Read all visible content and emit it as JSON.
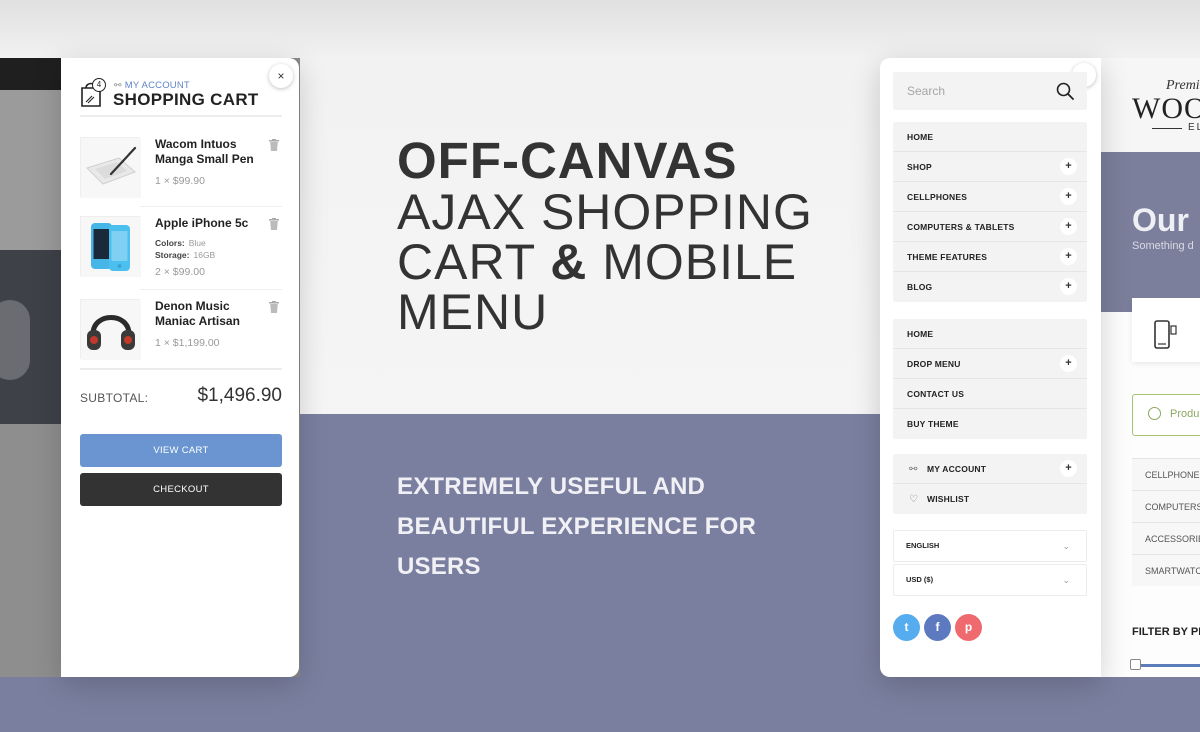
{
  "colors": {
    "accent_blue": "#6a95d1",
    "dark_button": "#333333",
    "bottom_band": "#7a7f9f",
    "twitter": "#55acee",
    "facebook": "#5d7ac0",
    "pinterest": "#ef6a6e"
  },
  "cart": {
    "count": "4",
    "my_account": "MY ACCOUNT",
    "title": "SHOPPING CART",
    "close_icon": "×",
    "items": [
      {
        "name": "Wacom Intuos Manga Small Pen",
        "qty_price": "1 × $99.90",
        "icon": "tablet-pen-thumbnail"
      },
      {
        "name": "Apple iPhone 5c",
        "attr1_label": "Colors:",
        "attr1_value": "Blue",
        "attr2_label": "Storage:",
        "attr2_value": "16GB",
        "qty_price": "2 × $99.00",
        "icon": "iphone-thumbnail"
      },
      {
        "name": "Denon Music Maniac Artisan",
        "qty_price": "1 × $1,199.00",
        "icon": "headphones-thumbnail"
      }
    ],
    "subtotal_label": "SUBTOTAL:",
    "subtotal_value": "$1,496.90",
    "view_cart": "VIEW CART",
    "checkout": "CHECKOUT"
  },
  "headline": {
    "line1": "OFF-CANVAS",
    "line2": "AJAX SHOPPING",
    "line3_a": "CART ",
    "line3_amp": "&",
    "line3_b": " MOBILE",
    "line4": "MENU",
    "sub1": "EXTREMELY USEFUL AND",
    "sub2": "BEAUTIFUL EXPERIENCE FOR",
    "sub3": "USERS"
  },
  "menu": {
    "close_icon": "×",
    "search_placeholder": "Search",
    "group1": [
      "HOME",
      "SHOP",
      "CELLPHONES",
      "COMPUTERS & TABLETS",
      "THEME FEATURES",
      "BLOG"
    ],
    "group2": [
      "HOME",
      "DROP MENU",
      "CONTACT US",
      "BUY THEME"
    ],
    "group3": [
      "MY ACCOUNT",
      "WISHLIST"
    ],
    "plus": "+",
    "language": "ENGLISH",
    "currency": "USD ($)",
    "chevron": "⌄",
    "social": {
      "twitter": "t",
      "facebook": "f",
      "pinterest": "p"
    }
  },
  "background_site": {
    "logo_small": "Premi",
    "logo_big": "WOO",
    "logo_sub": "ELE",
    "hero_title": "Our",
    "hero_sub": "Something d",
    "product_text": "Produ",
    "categories": [
      "CELLPHONES",
      "COMPUTERS",
      "ACCESSORIES",
      "SMARTWATCH"
    ],
    "filter_label": "FILTER BY PR"
  }
}
